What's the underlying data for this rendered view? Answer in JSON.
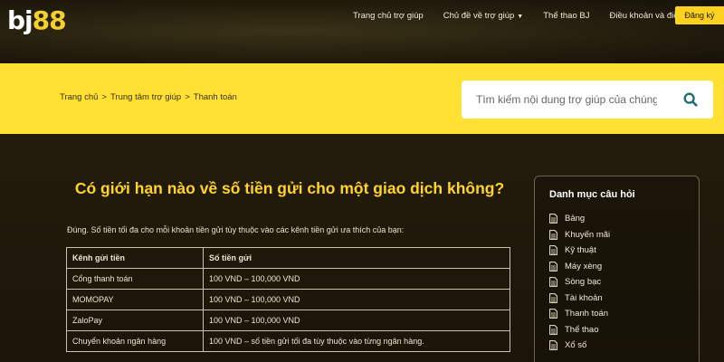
{
  "header": {
    "logo_prefix": "bj",
    "logo_number": "88",
    "nav": [
      {
        "label": "Trang chủ trợ giúp"
      },
      {
        "label": "Chủ đề về trợ giúp",
        "has_dropdown": true
      },
      {
        "label": "Thể thao BJ"
      },
      {
        "label": "Điều khoản và điều kiện"
      }
    ],
    "signup_label": "Đăng ký"
  },
  "breadcrumb": [
    "Trang chủ",
    "Trung tâm trợ giúp",
    "Thanh toán"
  ],
  "breadcrumb_separator": ">",
  "search": {
    "placeholder": "Tìm kiếm nội dung trợ giúp của chúng tôi",
    "icon": "search-icon"
  },
  "article": {
    "question": "Có giới hạn nào về số tiền gửi cho một giao dịch không?",
    "intro": "Đúng. Số tiền tối đa cho mỗi khoản tiền gửi tùy thuộc vào các kênh tiền gửi ưa thích của bạn:",
    "table": {
      "headers": [
        "Kênh gửi tiền",
        "Số tiền gửi"
      ],
      "rows": [
        [
          "Cổng thanh toán",
          "100 VND –  100,000 VND"
        ],
        [
          "MOMOPAY",
          "100 VND –  100,000 VND"
        ],
        [
          "ZaloPay",
          "100 VND –  100,000 VND"
        ],
        [
          "Chuyển khoản ngân hàng",
          "100 VND – số tiền gửi tối đa tùy thuộc vào từng ngân hàng."
        ]
      ]
    }
  },
  "sidebar": {
    "title": "Danh mục câu hỏi",
    "items": [
      "Bảng",
      "Khuyến mãi",
      "Kỹ thuật",
      "Máy xèng",
      "Sòng bạc",
      "Tài khoản",
      "Thanh toán",
      "Thể thao",
      "Xổ số"
    ],
    "icon": "document-icon"
  },
  "colors": {
    "accent_yellow": "#ffe033",
    "title_yellow": "#ffd42a",
    "button_yellow": "#ffd21f",
    "search_icon": "#1f6e6a",
    "background_dark": "#1a1408"
  }
}
